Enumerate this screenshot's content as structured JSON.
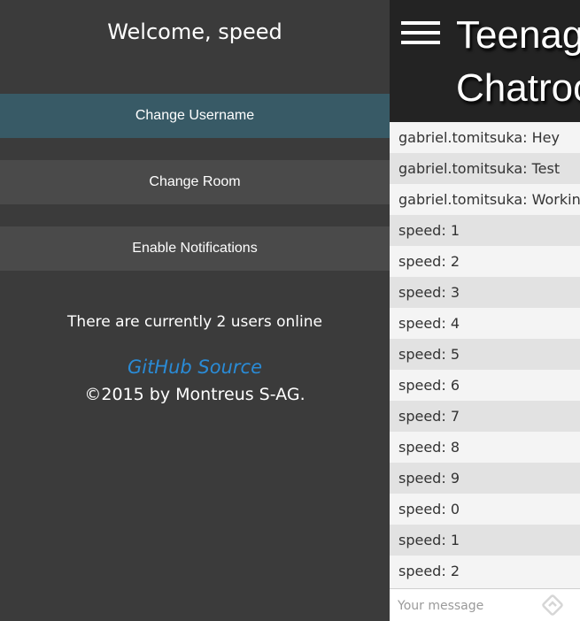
{
  "sidebar": {
    "welcome": "Welcome, speed",
    "buttons": {
      "change_username": "Change Username",
      "change_room": "Change Room",
      "enable_notifications": "Enable Notifications"
    },
    "users_online": "There are currently 2 users online",
    "github_link": "GitHub Source",
    "copyright": "©2015 by Montreus S-AG."
  },
  "header": {
    "title_line1": "Teenage",
    "title_line2": "Chatroom"
  },
  "messages": [
    "gabriel.tomitsuka: Hey",
    "gabriel.tomitsuka: Test",
    "gabriel.tomitsuka: Working.",
    "speed: 1",
    "speed: 2",
    "speed: 3",
    "speed: 4",
    "speed: 5",
    "speed: 6",
    "speed: 7",
    "speed: 8",
    "speed: 9",
    "speed: 0",
    "speed: 1",
    "speed: 2"
  ],
  "composer": {
    "placeholder": "Your message",
    "value": ""
  },
  "icons": {
    "menu": "hamburger-menu-icon",
    "send": "send-icon"
  },
  "colors": {
    "sidebar_bg": "#3b3b3b",
    "active_button": "#385a66",
    "button_bg": "#4a4a4a",
    "link": "#2a8bd6",
    "header_bg": "#232323"
  }
}
